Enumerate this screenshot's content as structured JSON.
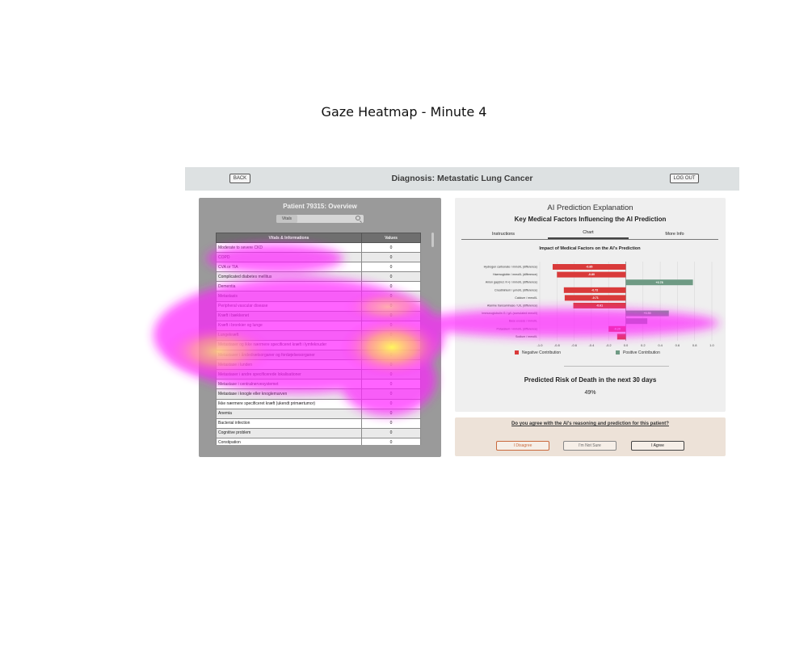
{
  "figure": {
    "title": "Gaze Heatmap - Minute 4"
  },
  "header": {
    "back_label": "BACK",
    "title": "Diagnosis: Metastatic Lung Cancer",
    "logout_label": "LOG OUT"
  },
  "patient_panel": {
    "title": "Patient 79315: Overview",
    "tab_label": "Vitals",
    "columns": [
      "Vitals & Informations",
      "Values"
    ],
    "rows": [
      [
        "Moderate to severe CKD",
        "0"
      ],
      [
        "COPD",
        "0"
      ],
      [
        "CVA or TIA",
        "0"
      ],
      [
        "Complicated diabetes mellitus",
        "0"
      ],
      [
        "Dementia",
        "0"
      ],
      [
        "Metastasis",
        "0"
      ],
      [
        "Peripheral vascular disease",
        "0"
      ],
      [
        "Kræft i bækkenet",
        "0"
      ],
      [
        "Kræft i bronkier og lunge",
        "0"
      ],
      [
        "Lungekræft",
        "0"
      ],
      [
        "Metastaser og ikke nærmere specificeret kræft i lymfeknuder",
        "0"
      ],
      [
        "Metastaser i åndedrætsorganer og fordøjelsesorganer",
        "0"
      ],
      [
        "Metastase i lunden",
        "0"
      ],
      [
        "Metastaser i andre specificerede lokalisationer",
        "0"
      ],
      [
        "Metastase i centralnervesystemet",
        "0"
      ],
      [
        "Metastase i knogle eller knoglemarven",
        "0"
      ],
      [
        "Ikke nærmere specificeret kræft (ukendt primærtumor)",
        "0"
      ],
      [
        "Anemia",
        "0"
      ],
      [
        "Bacterial infection",
        "0"
      ],
      [
        "Cognitive problem",
        "0"
      ],
      [
        "Constipation",
        "0"
      ]
    ]
  },
  "explanation_panel": {
    "title": "AI Prediction Explanation",
    "subtitle": "Key Medical Factors Influencing the AI Prediction",
    "tabs": [
      "Instructions",
      "Chart",
      "More Info"
    ],
    "active_tab": "Chart",
    "risk_label": "Predicted Risk of Death in the next 30 days",
    "risk_value": "49%"
  },
  "chart_data": {
    "type": "bar",
    "orientation": "horizontal",
    "title": "Impact of Medical Factors on the AI's Prediction",
    "categories": [
      "Hydrogen carbonate / mmol/L (difference)",
      "Haemoglobin / mmol/L (difference)",
      "Anion gap(incl. K+) / mmol/L (difference)",
      "Creatininium / µmol/L (difference)",
      "Calcium / mmol/L",
      "Alanine transaminase / U/L (difference)",
      "Immunoglobulin G / g/L (cumulated mmol/l)",
      "Base excess / mmol/L",
      "Potassium / mmol/L (difference)",
      "Sodium / mmol/L"
    ],
    "values": [
      -0.85,
      -0.8,
      0.78,
      -0.72,
      -0.71,
      -0.61,
      0.5,
      0.25,
      -0.2,
      -0.1
    ],
    "value_labels": [
      "-0.85",
      "-0.80",
      "+0.78",
      "-0.72",
      "-0.71",
      "-0.61",
      "+0.50",
      "",
      "-0.20",
      ""
    ],
    "xlim": [
      -1.0,
      1.0
    ],
    "xticks": [
      "-1.0",
      "-0.8",
      "-0.6",
      "-0.4",
      "-0.2",
      "0.0",
      "0.2",
      "0.4",
      "0.6",
      "0.8",
      "1.0"
    ],
    "legend": [
      {
        "name": "Negative Contribution",
        "color": "#d93a3a"
      },
      {
        "name": "Positive Contribution",
        "color": "#6f9a84"
      }
    ],
    "grid": true
  },
  "agreement": {
    "question": "Do you agree with the AI's reasoning and prediction for this patient?",
    "disagree_label": "I Disagree",
    "not_sure_label": "I'm Not Sure",
    "agree_label": "I Agree"
  },
  "colors": {
    "negative": "#d93a3a",
    "positive": "#6f9a84",
    "heat_low": "#ff00ff",
    "heat_high": "#ffff33"
  }
}
